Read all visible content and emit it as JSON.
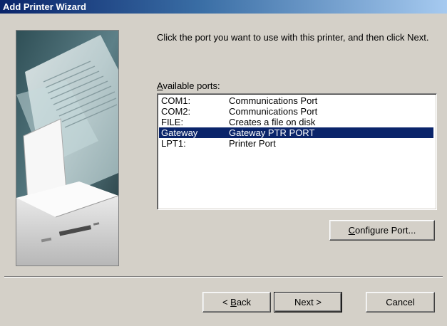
{
  "window": {
    "title": "Add Printer Wizard"
  },
  "content": {
    "instruction": "Click the port you want to use with this printer, and then click Next.",
    "ports_label_accel": "A",
    "ports_label_rest": "vailable ports:"
  },
  "ports": [
    {
      "name": "COM1:",
      "description": "Communications Port"
    },
    {
      "name": "COM2:",
      "description": "Communications Port"
    },
    {
      "name": "FILE:",
      "description": "Creates a file on disk"
    },
    {
      "name": "Gateway",
      "description": "Gateway PTR PORT"
    },
    {
      "name": "LPT1:",
      "description": "Printer Port"
    }
  ],
  "selected_port": "Gateway",
  "buttons": {
    "configure_accel": "C",
    "configure_rest": "onfigure Port...",
    "back_prefix": "< ",
    "back_accel": "B",
    "back_rest": "ack",
    "next": "Next >",
    "cancel": "Cancel"
  },
  "colors": {
    "dialog_bg": "#d4d0c8",
    "title_gradient_start": "#0a246a",
    "title_gradient_end": "#a6caf0",
    "selection_bg": "#0a246a",
    "selection_text": "#ffffff"
  },
  "icons": {
    "wizard_image": "printer-with-document-illustration"
  }
}
